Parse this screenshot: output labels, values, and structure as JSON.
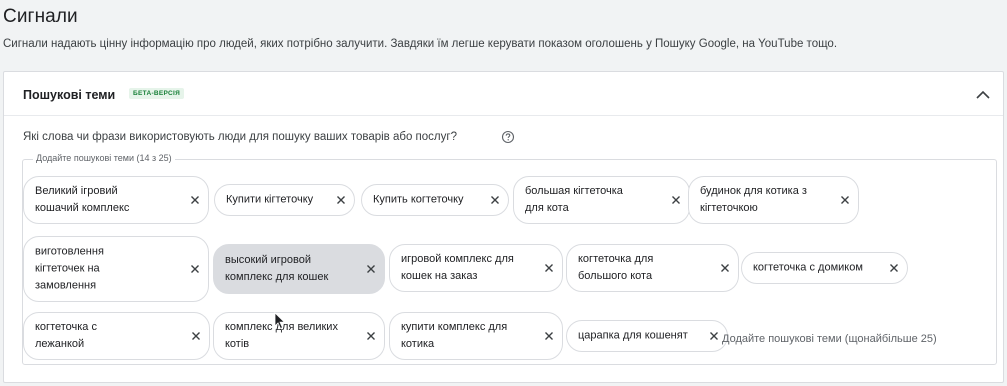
{
  "page": {
    "title": "Сигнали",
    "description": "Сигнали надають цінну інформацію про людей, яких потрібно залучити. Завдяки їм легше керувати показом оголошень у Пошуку Google, на YouTube тощо."
  },
  "panel": {
    "title": "Пошукові теми",
    "badge": "БЕТА-ВЕРСІЯ",
    "question": "Які слова чи фрази використовують люди для пошуку ваших товарів або послуг?",
    "field_legend": "Додайте пошукові теми (14 з 25)",
    "input_placeholder": "Додайте пошукові теми (щонайбільше 25)",
    "chips": [
      {
        "label": "Великий ігровий\nкошачий комплекс"
      },
      {
        "label": "Купити кігтеточку"
      },
      {
        "label": "Купить когтеточку"
      },
      {
        "label": "большая кігтеточка\nдля кота"
      },
      {
        "label": "будинок для котика з\nкігтеточкою"
      },
      {
        "label": "виготовлення\nкігтеточек на\nзамовлення"
      },
      {
        "label": "высокий игровой\nкомплекс для кошек"
      },
      {
        "label": "игровой комплекс для\nкошек на заказ"
      },
      {
        "label": "когтеточка для\nбольшого кота"
      },
      {
        "label": "когтеточка с домиком"
      },
      {
        "label": "когтеточка с\nлежанкой"
      },
      {
        "label": "комплекс для великих\nкотів"
      },
      {
        "label": "купити комплекс для\nкотика"
      },
      {
        "label": "царапка для кошенят"
      }
    ]
  },
  "colors": {
    "background": "#f1f3f4",
    "panel": "#ffffff",
    "border": "#dadce0",
    "beta_green": "#188038",
    "chip_hover": "#dadce0"
  },
  "icons": {
    "collapse": "chevron-up-icon",
    "help": "help-circle-icon",
    "remove": "close-icon"
  }
}
